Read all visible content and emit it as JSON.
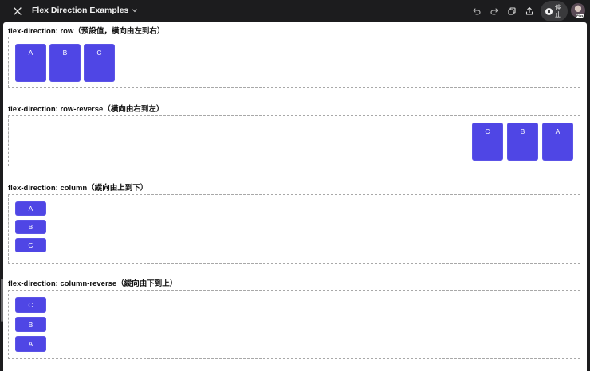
{
  "window": {
    "title": "Flex Direction Examples",
    "stop_label": "停止",
    "avatar_badge": "Plus"
  },
  "sections": [
    {
      "title": "flex-direction: row（預設值，橫向由左到右）",
      "items": [
        "A",
        "B",
        "C"
      ]
    },
    {
      "title": "flex-direction: row-reverse（橫向由右到左）",
      "items": [
        "A",
        "B",
        "C"
      ]
    },
    {
      "title": "flex-direction: column（縱向由上到下）",
      "items": [
        "A",
        "B",
        "C"
      ]
    },
    {
      "title": "flex-direction: column-reverse（縱向由下到上）",
      "items": [
        "A",
        "B",
        "C"
      ]
    }
  ],
  "colors": {
    "item_bg": "#4f46e5",
    "topbar_bg": "#1c1c1e",
    "dashed_border": "#a8a8a8"
  },
  "icons": [
    "close-icon",
    "chevron-down-icon",
    "undo-icon",
    "redo-icon",
    "copy-icon",
    "share-icon",
    "stop-icon"
  ]
}
